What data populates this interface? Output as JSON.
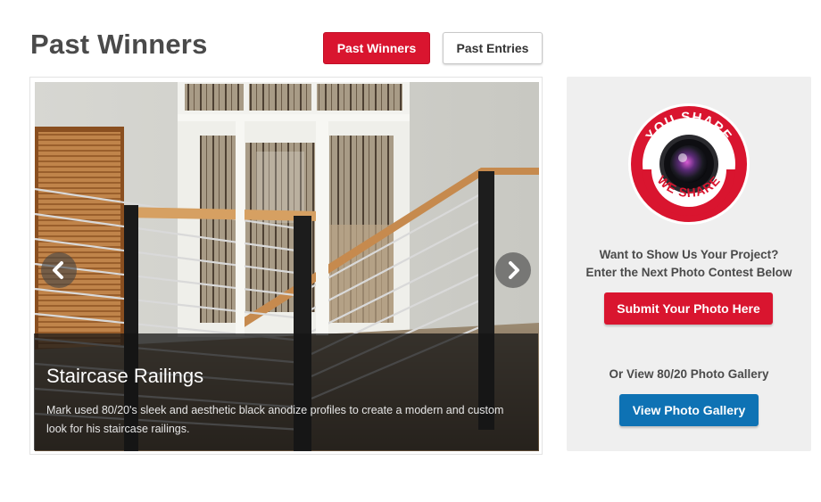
{
  "page": {
    "title": "Past Winners"
  },
  "tabs": {
    "past_winners": "Past Winners",
    "past_entries": "Past Entries"
  },
  "slider": {
    "caption_title": "Staircase Railings",
    "caption_text": "Mark used 80/20's sleek and aesthetic black anodize profiles to create a modern and custom look for his staircase railings.",
    "prev_icon": "chevron-left-icon",
    "next_icon": "chevron-right-icon"
  },
  "sidebar": {
    "badge_top_text": "YOU SHARE",
    "badge_bottom_text": "WE SHARE",
    "prompt_line1": "Want to Show Us Your Project?",
    "prompt_line2": "Enter the Next Photo Contest Below",
    "submit_label": "Submit Your Photo Here",
    "gallery_prompt": "Or View 80/20 Photo Gallery",
    "gallery_label": "View Photo Gallery"
  },
  "colors": {
    "brand_red": "#d9152f",
    "brand_blue": "#0e72b4",
    "panel_gray": "#efefef",
    "heading_gray": "#4a4a4a"
  }
}
